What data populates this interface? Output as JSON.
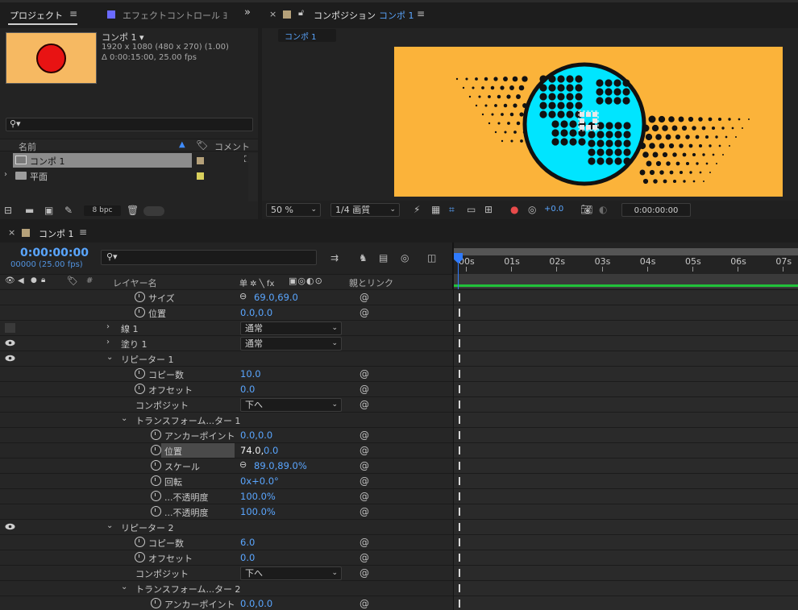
{
  "project": {
    "tab_project": "プロジェクト",
    "tab_effects": "エフェクトコントロール ﾖ",
    "comp_name": "コンポ 1 ▾",
    "comp_res": "1920 x 1080  (480 x 270) (1.00)",
    "comp_dur": "Δ 0:00:15:00, 25.00 fps",
    "search_placeholder": "",
    "col_name": "名前",
    "col_comment": "コメント",
    "items": [
      {
        "label": "コンポ 1",
        "color": "#b5a17a"
      },
      {
        "label": "平面",
        "color": "#d9d05c"
      }
    ],
    "bpc": "8 bpc"
  },
  "composition": {
    "tab_label": "コンポジション",
    "tab_comp": "コンポ 1",
    "subtab": "コンポ 1",
    "zoom": "50 %",
    "quality": "1/4 画質",
    "exposure": "+0.0",
    "timecode": "0:00:00:00"
  },
  "timeline": {
    "tab_label": "コンポ 1",
    "time": "0:00:00:00",
    "frames": "00000 (25.00 fps)",
    "col_layer": "レイヤー名",
    "col_switch": "单 ✲ ╲ fx",
    "col_parent": "親とリンク",
    "col_num": "#",
    "ruler": [
      "00s",
      "01s",
      "02s",
      "03s",
      "04s",
      "05s",
      "06s",
      "07s"
    ],
    "rows": [
      {
        "label": "サイズ",
        "value_link": true,
        "value": "69.0,69.0"
      },
      {
        "label": "位置",
        "value": "0.0,0.0"
      },
      {
        "label": "線 1",
        "blend": "通常"
      },
      {
        "label": "塗り 1",
        "blend": "通常"
      },
      {
        "label": "リピーター 1"
      },
      {
        "label": "コピー数",
        "value": "10.0"
      },
      {
        "label": "オフセット",
        "value": "0.0"
      },
      {
        "label": "コンポジット",
        "blend": "下へ"
      },
      {
        "label": "トランスフォーム...ター 1"
      },
      {
        "label": "アンカーポイント",
        "value": "0.0,0.0"
      },
      {
        "label": "位置",
        "value_a": "74.0,",
        "value_b": "0.0"
      },
      {
        "label": "スケール",
        "value_link": true,
        "value": "89.0,89.0%"
      },
      {
        "label": "回転",
        "value": "0x+0.0°"
      },
      {
        "label": "...不透明度",
        "value": "100.0%"
      },
      {
        "label": "...不透明度",
        "value": "100.0%"
      },
      {
        "label": "リピーター 2"
      },
      {
        "label": "コピー数",
        "value": "6.0"
      },
      {
        "label": "オフセット",
        "value": "0.0"
      },
      {
        "label": "コンポジット",
        "blend": "下へ"
      },
      {
        "label": "トランスフォーム...ター 2"
      },
      {
        "label": "アンカーポイント",
        "value": "0.0,0.0"
      }
    ]
  },
  "colors": {
    "accent": "#5aa6ff",
    "orange": "#fbb33a",
    "cyan": "#00e5ff",
    "green": "#21c13a"
  }
}
